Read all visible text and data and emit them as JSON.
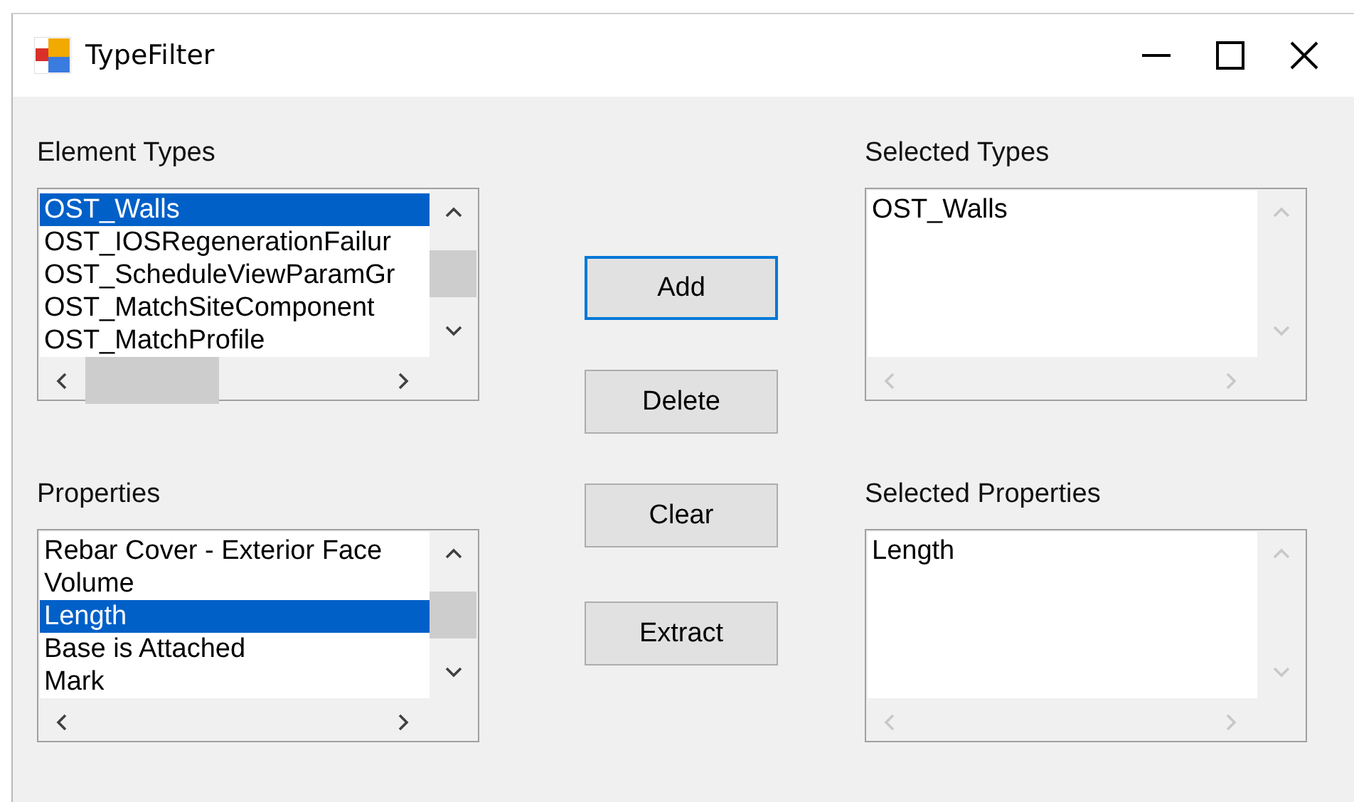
{
  "window": {
    "title": "TypeFilter"
  },
  "element_types": {
    "label": "Element Types",
    "items": [
      {
        "text": "OST_Walls",
        "selected": true
      },
      {
        "text": "OST_IOSRegenerationFailur",
        "selected": false
      },
      {
        "text": "OST_ScheduleViewParamGr",
        "selected": false
      },
      {
        "text": "OST_MatchSiteComponent",
        "selected": false
      },
      {
        "text": "OST_MatchProfile",
        "selected": false
      }
    ]
  },
  "properties": {
    "label": "Properties",
    "items": [
      {
        "text": "Rebar Cover - Exterior Face",
        "selected": false
      },
      {
        "text": "Volume",
        "selected": false
      },
      {
        "text": "Length",
        "selected": true
      },
      {
        "text": "Base is Attached",
        "selected": false
      },
      {
        "text": "Mark",
        "selected": false
      }
    ]
  },
  "buttons": [
    {
      "label": "Add",
      "focused": true
    },
    {
      "label": "Delete",
      "focused": false
    },
    {
      "label": "Clear",
      "focused": false
    },
    {
      "label": "Extract",
      "focused": false
    }
  ],
  "selected_types": {
    "label": "Selected Types",
    "items": [
      {
        "text": "OST_Walls",
        "selected": false
      }
    ]
  },
  "selected_properties": {
    "label": "Selected Properties",
    "items": [
      {
        "text": "Length",
        "selected": false
      }
    ]
  }
}
